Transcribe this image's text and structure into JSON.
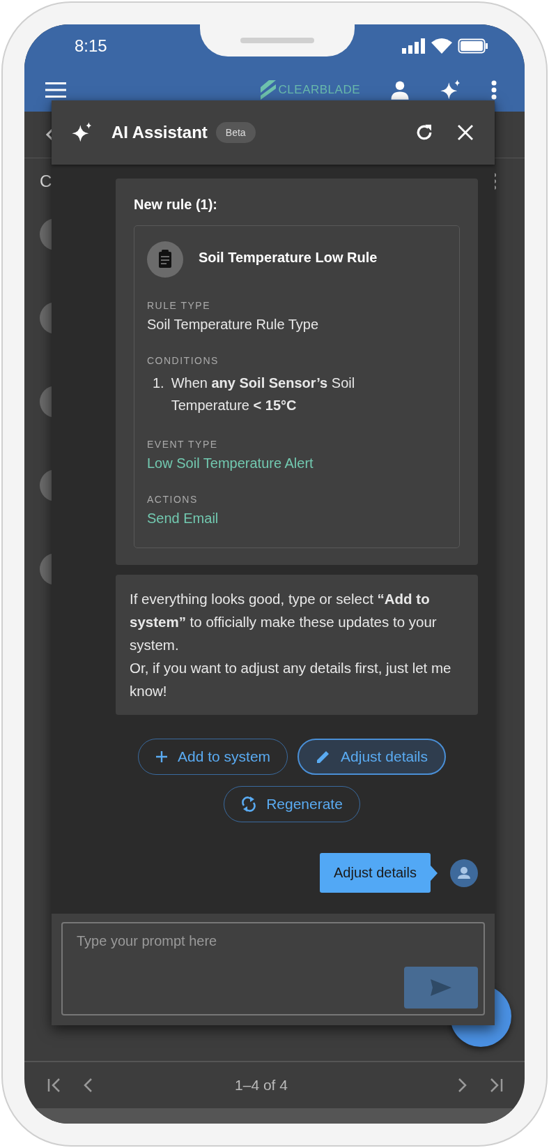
{
  "status_bar": {
    "time": "8:15"
  },
  "app_bar": {
    "logo": "**CLEAR**BLADE"
  },
  "page": {
    "title": "C"
  },
  "assistant": {
    "title": "AI Assistant",
    "badge": "Beta",
    "messages": [
      {
        "kind": "rule_summary",
        "heading": "New rule (1):",
        "rule": {
          "name": "Soil Temperature Low Rule",
          "fields": [
            {
              "kind": "text",
              "label": "RULE TYPE",
              "value": "Soil Temperature Rule Type"
            },
            {
              "kind": "list",
              "label": "CONDITIONS",
              "items": [
                {
                  "number": "1.",
                  "text": "When **any Soil Sensor’s** Soil Temperature **< 15°C**"
                }
              ]
            },
            {
              "kind": "link",
              "label": "EVENT TYPE",
              "value": "Low Soil Temperature Alert"
            },
            {
              "kind": "link",
              "label": "ACTIONS",
              "value": "Send Email"
            }
          ]
        }
      },
      {
        "kind": "assistant_text",
        "paragraphs": [
          "If everything looks good, type or select **“Add to system”** to officially make these updates to your system.",
          "Or, if you want to adjust any details first, just let me know!"
        ]
      },
      {
        "kind": "suggestions",
        "buttons": [
          {
            "kind": "add",
            "label": "Add to system",
            "selected": false
          },
          {
            "kind": "adjust",
            "label": "Adjust details",
            "selected": true
          },
          {
            "kind": "regenerate",
            "label": "Regenerate",
            "selected": false
          }
        ]
      },
      {
        "kind": "user_text",
        "text": "Adjust details"
      }
    ],
    "prompt": {
      "placeholder": "Type your prompt here",
      "send_disabled": true
    }
  },
  "pagination": {
    "range": "1–4 of 4"
  }
}
